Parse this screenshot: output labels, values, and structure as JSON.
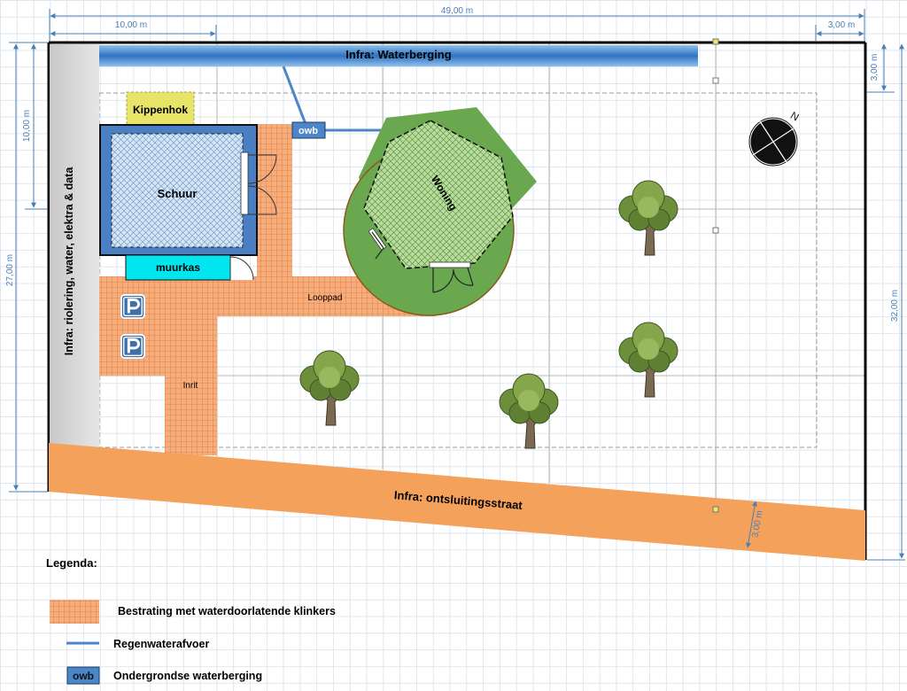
{
  "dimensions": {
    "total_width": "49,00 m",
    "left_width": "10,00 m",
    "right_width": "3,00 m",
    "left_height_top": "10,00 m",
    "left_height_total": "27,00 m",
    "right_height_top": "3,00 m",
    "right_height_total": "32,00 m",
    "street_width": "3,00 m"
  },
  "labels": {
    "waterberging": "Infra: Waterberging",
    "riolering": "Infra: riolering, water, elektra & data",
    "ontsluitingsstraat": "Infra: ontsluitingsstraat",
    "kippenhok": "Kippenhok",
    "schuur": "Schuur",
    "muurkas": "muurkas",
    "owb": "owb",
    "woning": "Woning",
    "looppad": "Looppad",
    "inrit": "Inrit",
    "parking": "P",
    "compass": "N"
  },
  "legend": {
    "title": "Legenda:",
    "paving": "Bestrating met waterdoorlatende klinkers",
    "rainwater": "Regenwaterafvoer",
    "storage_symbol": "owb",
    "storage": "Ondergrondse waterberging"
  },
  "colors": {
    "paving": "#f4a46e",
    "paving_grid": "#e06a2a",
    "water": "#4a86c8",
    "shed": "#4a7fc4",
    "shed_fill": "#cfe3f7",
    "muurkas": "#00e5ee",
    "kippenhok": "#e8e46a",
    "garden": "#6aa84f",
    "house_fill": "#b8d99a",
    "street": "#f4a15c",
    "infra_grey": "#dcdcdc",
    "border": "#000000",
    "dimension": "#4a7fb5"
  },
  "icons": [
    "tree-icon",
    "parking-icon",
    "compass-icon",
    "door-icon"
  ]
}
